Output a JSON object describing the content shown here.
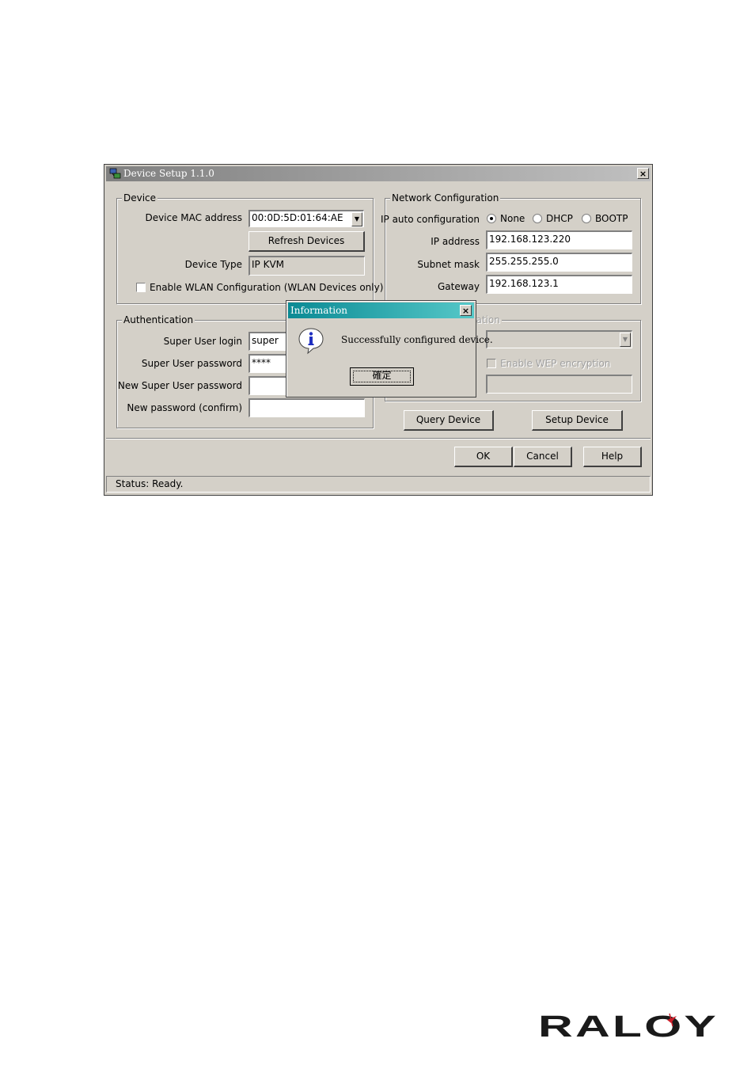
{
  "window": {
    "title": "Device Setup 1.1.0",
    "close_glyph": "×",
    "icon": "network-computer-icon"
  },
  "device_group": {
    "legend": "Device",
    "mac_label": "Device MAC address",
    "mac_value": "00:0D:5D:01:64:AE",
    "refresh_label": "Refresh Devices",
    "type_label": "Device Type",
    "type_value": "IP KVM",
    "wlan_checkbox_label": "Enable WLAN Configuration (WLAN Devices only)",
    "wlan_checked": false
  },
  "network_group": {
    "legend": "Network Configuration",
    "auto_label": "IP auto configuration",
    "options": [
      "None",
      "DHCP",
      "BOOTP"
    ],
    "selected_option": "None",
    "ip_label": "IP address",
    "ip_value": "192.168.123.220",
    "mask_label": "Subnet mask",
    "mask_value": "255.255.255.0",
    "gateway_label": "Gateway",
    "gateway_value": "192.168.123.1"
  },
  "auth_group": {
    "legend": "Authentication",
    "login_label": "Super User login",
    "login_value": "super",
    "password_label": "Super User password",
    "password_value": "****",
    "new_password_label": "New Super User password",
    "new_password_value": "",
    "confirm_label": "New password (confirm)",
    "confirm_value": ""
  },
  "wlan_group": {
    "legend_partial": "uration",
    "wep_label": "Enable WEP encryption",
    "wep_checked": false,
    "ssid_value": "",
    "key_value": ""
  },
  "actions": {
    "query_label": "Query Device",
    "setup_label": "Setup Device"
  },
  "footer": {
    "ok_label": "OK",
    "cancel_label": "Cancel",
    "help_label": "Help"
  },
  "status": {
    "text": "Status: Ready."
  },
  "dialog": {
    "title": "Information",
    "close_glyph": "×",
    "message": "Successfully configured device.",
    "ok_label": "確定",
    "icon": "info-icon"
  },
  "brand": {
    "logo_text": "RALOY",
    "accent_color": "#cc1f2a"
  }
}
